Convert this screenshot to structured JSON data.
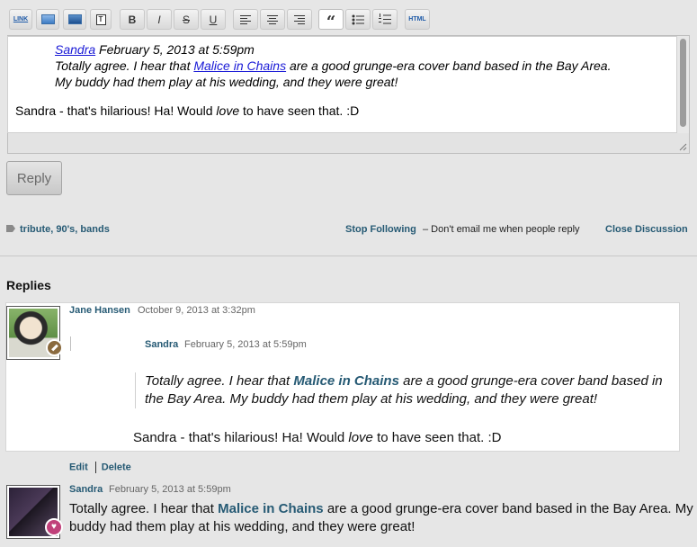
{
  "toolbar": {
    "link": "LINK",
    "html": "HTML",
    "t_icon": "T",
    "bold": "B",
    "italic": "I",
    "strike": "S",
    "underline": "U",
    "quote": "“"
  },
  "editor": {
    "quote_author": "Sandra",
    "quote_time": " February 5, 2013 at 5:59pm",
    "quote_line1_pre": "Totally agree. I hear that ",
    "quote_link": "Malice in Chains",
    "quote_line1_post": " are a good grunge-era cover band based in the Bay Area.",
    "quote_line2": "My buddy had them play at his wedding, and they were great!",
    "reply_pre": "Sandra - that's hilarious! Ha! Would ",
    "reply_em": "love",
    "reply_post": " to have seen that. :D"
  },
  "reply_button": "Reply",
  "meta": {
    "tags": "tribute, 90's, bands",
    "stop_following": "Stop Following",
    "stop_following_desc": "– Don't email me when people reply",
    "close_discussion": "Close Discussion"
  },
  "replies_heading": "Replies",
  "reply1": {
    "author": "Jane Hansen",
    "time": "October 9, 2013 at 3:32pm",
    "nested_author": "Sandra",
    "nested_time": "February 5, 2013 at 5:59pm",
    "quote_pre": "Totally agree. I hear that ",
    "quote_link": "Malice in Chains",
    "quote_post": " are a good grunge-era cover band based in the Bay Area. My buddy had them play at his wedding, and they were great!",
    "text_pre": "Sandra - that's hilarious! Ha! Would ",
    "text_em": "love",
    "text_post": " to have seen that. :D",
    "edit": "Edit",
    "delete": "Delete"
  },
  "post2": {
    "author": "Sandra",
    "time": "February 5, 2013 at 5:59pm",
    "text_pre": "Totally agree. I hear that ",
    "text_link": "Malice in Chains",
    "text_post": " are a good grunge-era cover band based in the Bay Area. My buddy had them play at his wedding, and they were great!"
  }
}
